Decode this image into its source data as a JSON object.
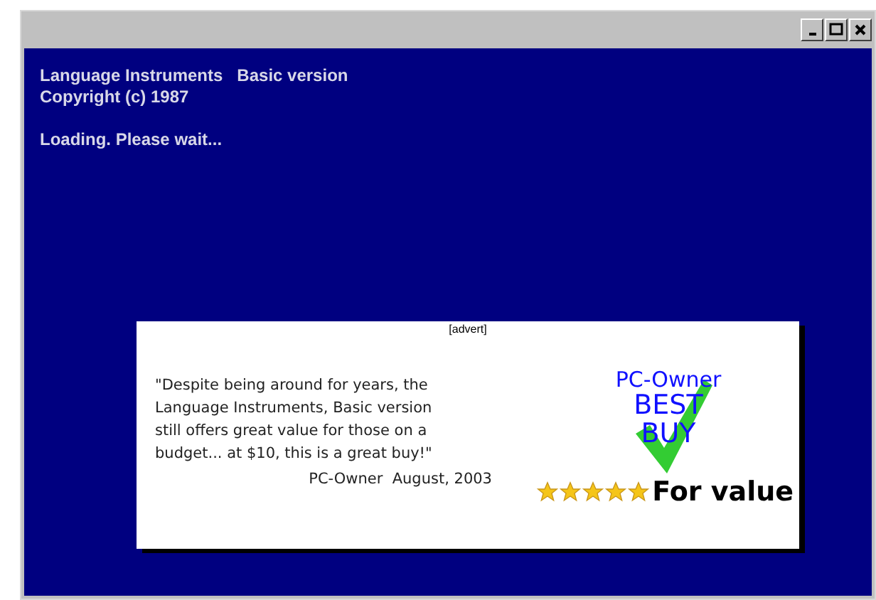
{
  "console": {
    "title_line": "Language Instruments   Basic version",
    "copyright": "Copyright (c) 1987",
    "status": "Loading. Please wait..."
  },
  "advert": {
    "label": "[advert]",
    "quote": "\"Despite being around for years, the Language Instruments, Basic version still offers great value for those on a budget... at $10, this is a great buy!\"",
    "attribution": "PC-Owner  August, 2003",
    "award": {
      "publisher": "PC-Owner",
      "title_line_1": "BEST",
      "title_line_2": "BUY",
      "stars": 5,
      "caption": "For value"
    }
  }
}
